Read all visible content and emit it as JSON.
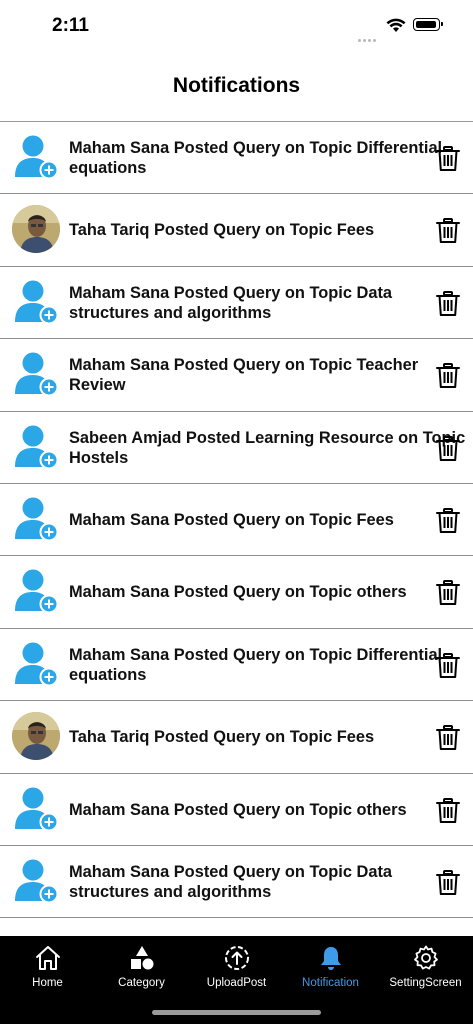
{
  "status": {
    "time": "2:11"
  },
  "header": {
    "title": "Notifications"
  },
  "notifications": [
    {
      "text": "Maham Sana Posted Query on Topic Differential equations",
      "avatar": "user-placeholder"
    },
    {
      "text": "Taha Tariq Posted Query on Topic Fees",
      "avatar": "user-photo"
    },
    {
      "text": "Maham Sana Posted Query on Topic Data structures and algorithms",
      "avatar": "user-placeholder"
    },
    {
      "text": "Maham Sana Posted Query on Topic Teacher Review",
      "avatar": "user-placeholder"
    },
    {
      "text": "Sabeen Amjad Posted Learning Resource on Topic Hostels",
      "avatar": "user-placeholder"
    },
    {
      "text": "Maham Sana Posted Query on Topic Fees",
      "avatar": "user-placeholder"
    },
    {
      "text": "Maham Sana Posted Query on Topic others",
      "avatar": "user-placeholder"
    },
    {
      "text": "Maham Sana Posted Query on Topic Differential equations",
      "avatar": "user-placeholder"
    },
    {
      "text": "Taha Tariq Posted Query on Topic Fees",
      "avatar": "user-photo"
    },
    {
      "text": "Maham Sana Posted Query on Topic others",
      "avatar": "user-placeholder"
    },
    {
      "text": "Maham Sana Posted Query on Topic Data structures and algorithms",
      "avatar": "user-placeholder"
    }
  ],
  "tabs": [
    {
      "label": "Home",
      "icon": "home-icon"
    },
    {
      "label": "Category",
      "icon": "category-icon"
    },
    {
      "label": "UploadPost",
      "icon": "upload-icon"
    },
    {
      "label": "Notification",
      "icon": "bell-icon",
      "active": true
    },
    {
      "label": "SettingScreen",
      "icon": "gear-icon"
    }
  ],
  "colors": {
    "accent": "#3f9be8",
    "avatar_blue": "#2ba6e6",
    "tabbar_bg": "#000000"
  }
}
